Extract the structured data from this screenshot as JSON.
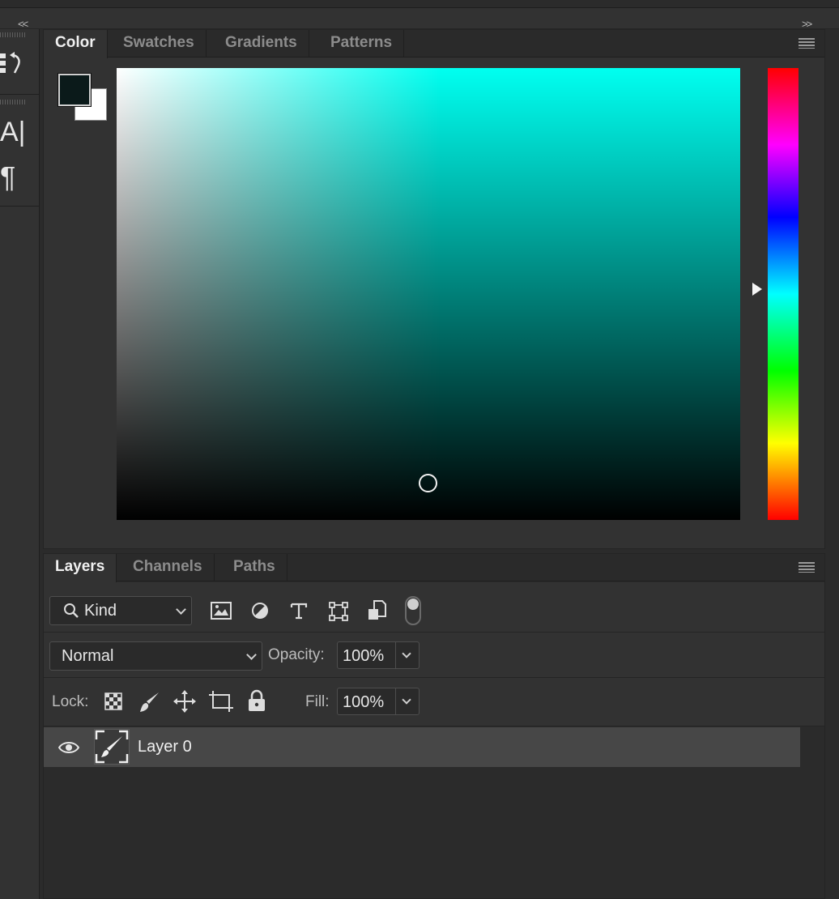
{
  "collapse": {
    "left": "<<",
    "right": ">>"
  },
  "left_tools": {
    "type_glyph": "A|",
    "paragraph_glyph": "¶"
  },
  "color_panel": {
    "tabs": [
      {
        "label": "Color",
        "active": true
      },
      {
        "label": "Swatches",
        "active": false
      },
      {
        "label": "Gradients",
        "active": false
      },
      {
        "label": "Patterns",
        "active": false
      }
    ],
    "foreground_color": "#0b1a1a",
    "background_color": "#ffffff",
    "hue_color": "#00fff0",
    "picker_position_fraction": {
      "saturation": 0.5,
      "brightness": 0.08
    },
    "hue_position_fraction": 0.49
  },
  "layers_panel": {
    "tabs": [
      {
        "label": "Layers",
        "active": true
      },
      {
        "label": "Channels",
        "active": false
      },
      {
        "label": "Paths",
        "active": false
      }
    ],
    "filter": {
      "label": "Kind"
    },
    "blend_mode": "Normal",
    "opacity": {
      "label": "Opacity:",
      "value": "100%"
    },
    "lock": {
      "label": "Lock:"
    },
    "fill": {
      "label": "Fill:",
      "value": "100%"
    },
    "layers": [
      {
        "name": "Layer 0",
        "visible": true,
        "selected": true
      }
    ]
  }
}
